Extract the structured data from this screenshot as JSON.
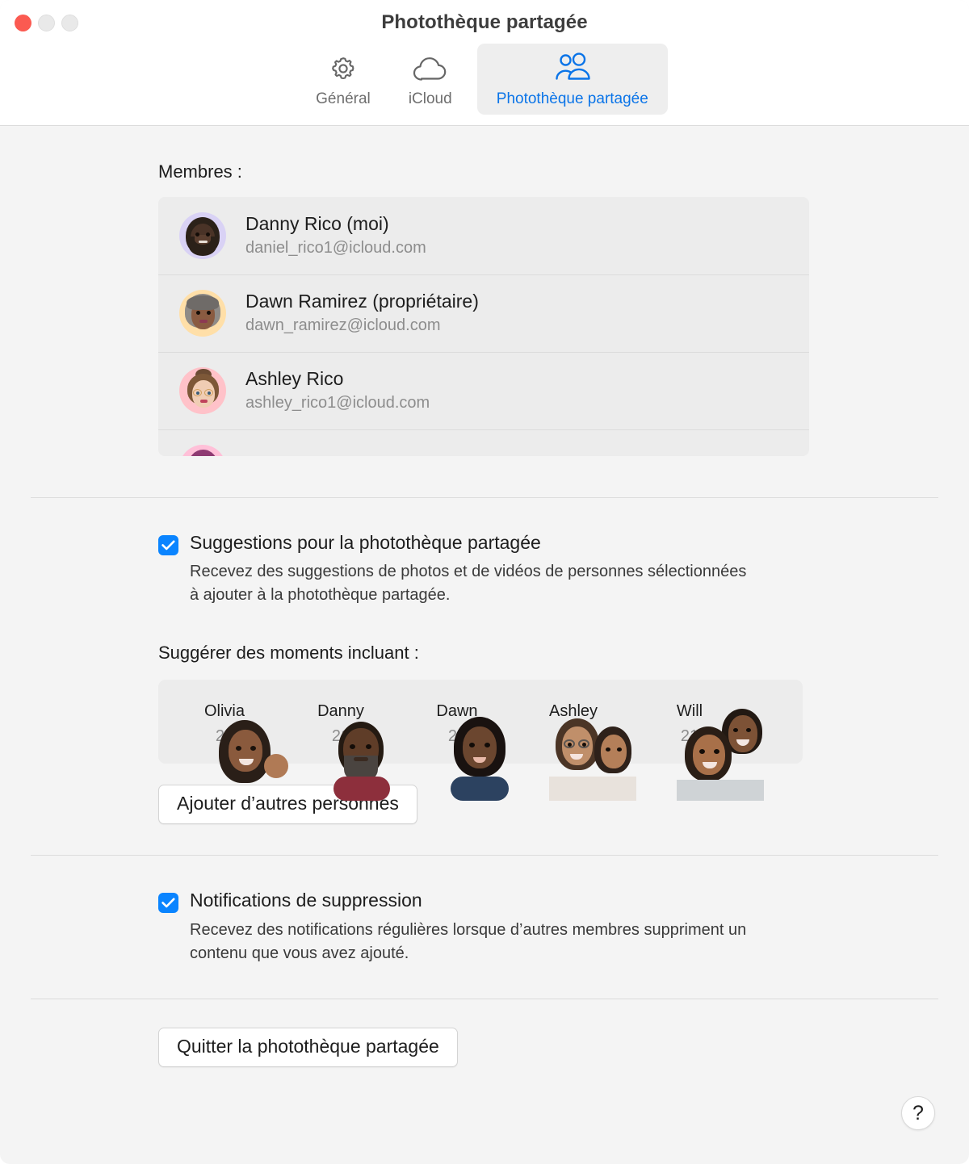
{
  "window": {
    "title": "Photothèque partagée",
    "traffic_lights": [
      "close",
      "minimize",
      "zoom"
    ]
  },
  "toolbar": {
    "tabs": [
      {
        "id": "general",
        "label": "Général",
        "icon": "gear-icon",
        "selected": false
      },
      {
        "id": "icloud",
        "label": "iCloud",
        "icon": "cloud-icon",
        "selected": false
      },
      {
        "id": "shared",
        "label": "Photothèque partagée",
        "icon": "two-people-icon",
        "selected": true
      }
    ],
    "accent_color": "#0a74e8"
  },
  "members_section": {
    "label": "Membres :",
    "members": [
      {
        "name": "Danny Rico (moi)",
        "email": "daniel_rico1@icloud.com",
        "avatar_bg": "#d9d2f5"
      },
      {
        "name": "Dawn Ramirez (propriétaire)",
        "email": "dawn_ramirez@icloud.com",
        "avatar_bg": "#ffdfa8"
      },
      {
        "name": "Ashley Rico",
        "email": "ashley_rico1@icloud.com",
        "avatar_bg": "#ffc2c9"
      }
    ],
    "partial_member_avatar_bg": "#ffc0d8"
  },
  "suggestions": {
    "checkbox_checked": true,
    "title": "Suggestions pour la photothèque partagée",
    "description": "Recevez des suggestions de photos et de vidéos de personnes sélectionnées à ajouter à la photothèque partagée.",
    "people_label": "Suggérer des moments incluant :",
    "people": [
      {
        "name": "Olivia",
        "count": "21"
      },
      {
        "name": "Danny",
        "count": "21"
      },
      {
        "name": "Dawn",
        "count": "21"
      },
      {
        "name": "Ashley",
        "count": "21"
      },
      {
        "name": "Will",
        "count": "21"
      }
    ],
    "add_people_button": "Ajouter d’autres personnes"
  },
  "notifications": {
    "checkbox_checked": true,
    "title": "Notifications de suppression",
    "description": "Recevez des notifications régulières lorsque d’autres membres suppriment un contenu que vous avez ajouté."
  },
  "footer": {
    "leave_button": "Quitter la photothèque partagée",
    "help_button": "?"
  },
  "colors": {
    "accent": "#0a74e8",
    "checkbox": "#0a84ff",
    "window_bg": "#f4f4f4",
    "panel_bg": "#ececec",
    "toolbar_bg": "#ffffff",
    "divider": "#dcdcdc"
  }
}
